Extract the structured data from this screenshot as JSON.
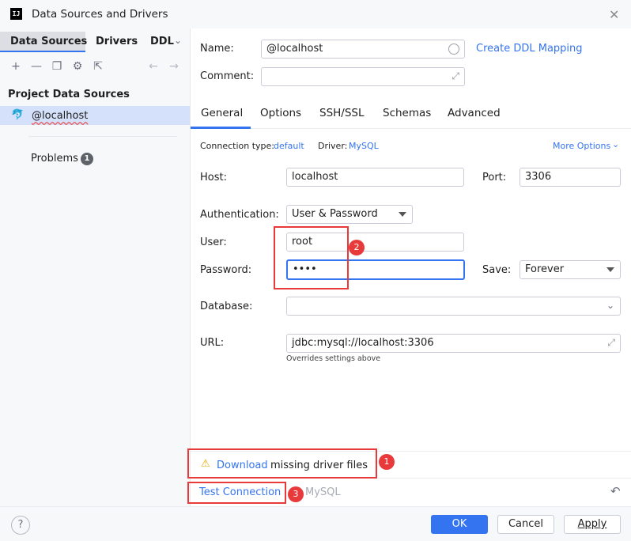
{
  "window": {
    "title": "Data Sources and Drivers",
    "logo_text": "IJ",
    "close": "✕"
  },
  "left": {
    "tabs": [
      "Data Sources",
      "Drivers",
      "DDL"
    ],
    "section_title": "Project Data Sources",
    "datasource": "@localhost",
    "problems_label": "Problems",
    "problems_count": "1"
  },
  "form": {
    "name_label": "Name:",
    "name_value": "@localhost",
    "create_ddl_link": "Create DDL Mapping",
    "comment_label": "Comment:",
    "tabs": [
      "General",
      "Options",
      "SSH/SSL",
      "Schemas",
      "Advanced"
    ],
    "conn_type_label": "Connection type:",
    "conn_type_value": "default",
    "driver_label": "Driver:",
    "driver_value": "MySQL",
    "more_options": "More Options",
    "host_label": "Host:",
    "host_value": "localhost",
    "port_label": "Port:",
    "port_value": "3306",
    "auth_label": "Authentication:",
    "auth_value": "User & Password",
    "user_label": "User:",
    "user_value": "root",
    "password_label": "Password:",
    "password_value": "••••",
    "save_label": "Save:",
    "save_value": "Forever",
    "database_label": "Database:",
    "url_label": "URL:",
    "url_value": "jdbc:mysql://localhost:3306",
    "url_hint": "Overrides settings above"
  },
  "driver_warning": {
    "link": "Download",
    "text": "missing driver files"
  },
  "test_connection": {
    "label": "Test Connection",
    "driver": "MySQL"
  },
  "annotations": [
    "1",
    "2",
    "3"
  ],
  "footer": {
    "help": "?",
    "ok": "OK",
    "cancel": "Cancel",
    "apply": "Apply"
  },
  "colors": {
    "accent": "#3574f0",
    "annotation_red": "#e83a3a"
  }
}
